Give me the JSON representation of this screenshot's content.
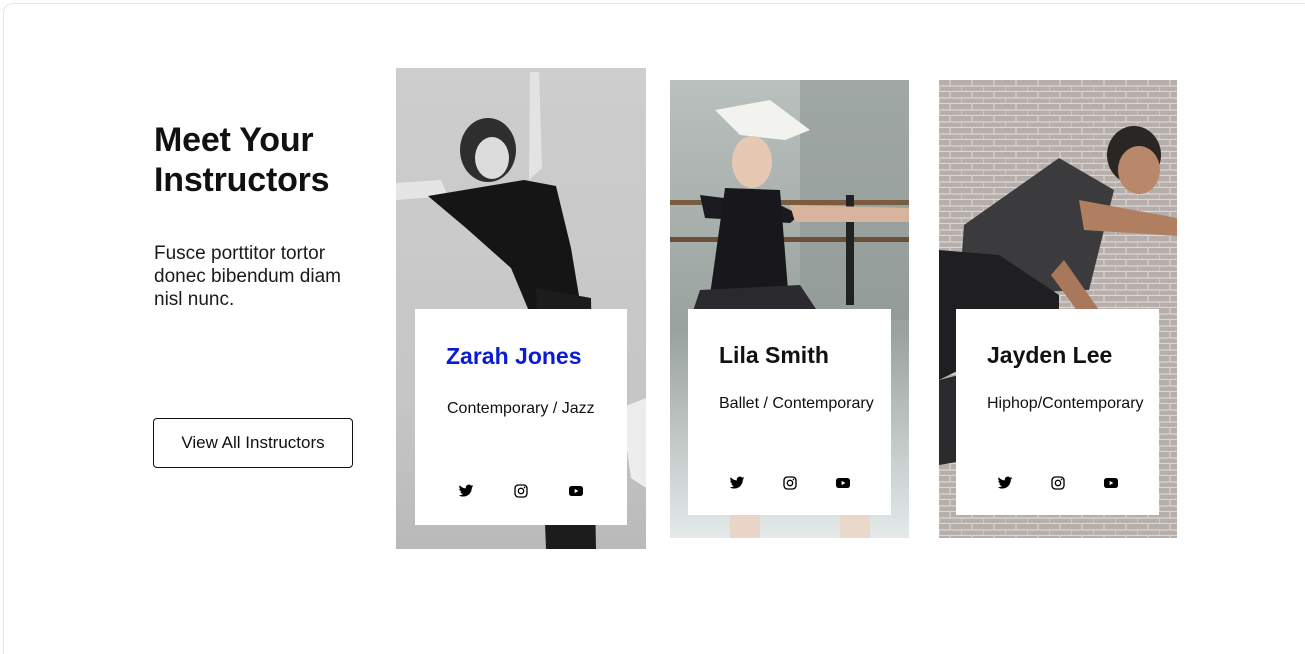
{
  "section": {
    "title": "Meet Your Instructors",
    "description": "Fusce porttitor tortor donec bibendum diam nisl nunc.",
    "button_label": "View All Instructors"
  },
  "instructors": [
    {
      "name": "Zarah Jones",
      "styles": "Contemporary / Jazz",
      "name_color": "#0a1bd1",
      "socials": [
        "twitter-icon",
        "instagram-icon",
        "youtube-icon"
      ]
    },
    {
      "name": "Lila Smith",
      "styles": "Ballet / Contemporary",
      "name_color": "#111111",
      "socials": [
        "twitter-icon",
        "instagram-icon",
        "youtube-icon"
      ]
    },
    {
      "name": "Jayden Lee",
      "styles": "Hiphop/Contemporary",
      "name_color": "#111111",
      "socials": [
        "twitter-icon",
        "instagram-icon",
        "youtube-icon"
      ]
    }
  ]
}
